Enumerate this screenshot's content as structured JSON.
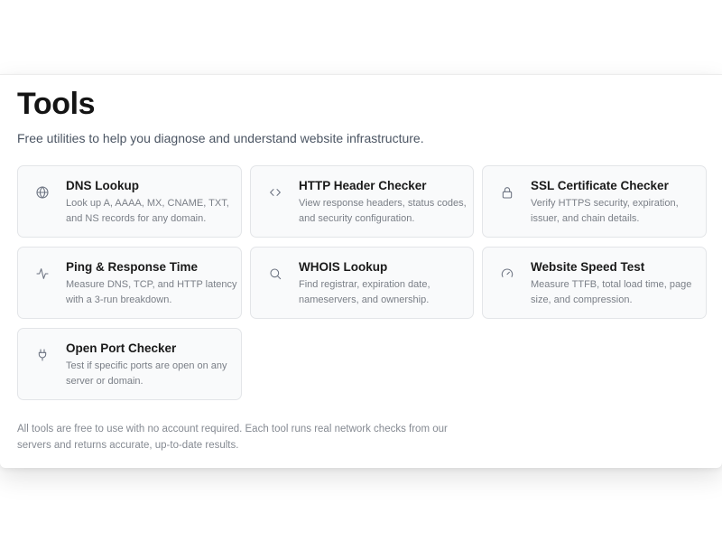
{
  "header": {
    "title": "Tools",
    "subtitle": "Free utilities to help you diagnose and understand website infrastructure."
  },
  "tools": [
    {
      "name": "DNS Lookup",
      "description": "Look up A, AAAA, MX, CNAME, TXT, and NS records for any domain.",
      "icon": "globe-icon"
    },
    {
      "name": "HTTP Header Checker",
      "description": "View response headers, status codes, and security configuration.",
      "icon": "code-icon"
    },
    {
      "name": "SSL Certificate Checker",
      "description": "Verify HTTPS security, expiration, issuer, and chain details.",
      "icon": "lock-icon"
    },
    {
      "name": "Ping & Response Time",
      "description": "Measure DNS, TCP, and HTTP latency with a 3-run breakdown.",
      "icon": "activity-icon"
    },
    {
      "name": "WHOIS Lookup",
      "description": "Find registrar, expiration date, nameservers, and ownership.",
      "icon": "search-icon"
    },
    {
      "name": "Website Speed Test",
      "description": "Measure TTFB, total load time, page size, and compression.",
      "icon": "gauge-icon"
    },
    {
      "name": "Open Port Checker",
      "description": "Test if specific ports are open on any server or domain.",
      "icon": "plug-icon"
    }
  ],
  "footer": {
    "note": "All tools are free to use with no account required. Each tool runs real network checks from our servers and returns accurate, up-to-date results."
  }
}
